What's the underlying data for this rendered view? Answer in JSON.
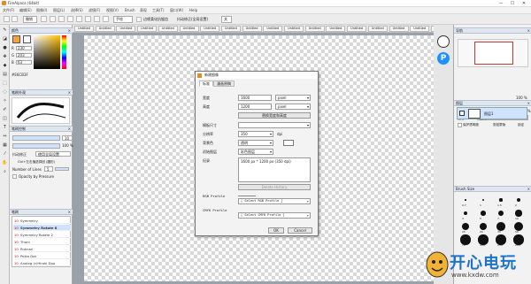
{
  "window": {
    "title": "FireAlpaca (64bit)",
    "minimize": "—",
    "maximize": "☐",
    "close": "✕"
  },
  "menu": [
    "文件(F)",
    "编辑(E)",
    "图像(I)",
    "图层(L)",
    "选择(S)",
    "滤镜(F)",
    "视图(V)",
    "Brush",
    "表现",
    "工具(T)",
    "窗口(W)",
    "Help"
  ],
  "toolbar": {
    "undo_label": "撤销",
    "mode": "手绘",
    "checkbox_label": "边缘柔化抗锯齿",
    "snap": "抖动修正(全局设置)",
    "extra": "关"
  },
  "doc_tabs": [
    "Untitled",
    "Untitled",
    "Untitled",
    "Untitled",
    "Untitled",
    "Untitled",
    "Untitled",
    "Untitled",
    "Untitled",
    "Untitled",
    "Untitled",
    "Untitled",
    "Untitled",
    "Untitled",
    "Untitled",
    "Untitled",
    "Untitled",
    "Untitled"
  ],
  "color_panel": {
    "title": "颜色",
    "r": "230",
    "g": "203",
    "b": "63",
    "hex": "#E6CB3F",
    "swatch_a": "#F4A23C",
    "swatch_b": "#FFFFFF"
  },
  "brush_preview": {
    "title": "笔刷外观"
  },
  "brush_control": {
    "title": "笔刷控制",
    "size": "10",
    "opacity": "100 %",
    "blend_label": "抖动修正",
    "blend_value": "使用全局设置",
    "shortcut_label": "Ctrl+左击值选择回 (圆形)",
    "number_of_lines_label": "Number of Lines",
    "number_of_lines": "5",
    "opacity_by_pressure": "Opacity by Pressure"
  },
  "brush_list": {
    "title": "笔刷",
    "items": [
      {
        "n": "10",
        "name": "Symmetry"
      },
      {
        "n": "10",
        "name": "Symmetry Rotate 8"
      },
      {
        "n": "10",
        "name": "Symmetry Rotate 2"
      },
      {
        "n": "10",
        "name": "Thorn"
      },
      {
        "n": "10",
        "name": "Ruknari"
      },
      {
        "n": "10",
        "name": "Polka Dot"
      },
      {
        "n": "10",
        "name": "Analog (c)Hiroki Dpa"
      }
    ],
    "selected_index": 1
  },
  "navigator": {
    "title": "导航",
    "zoom": "100 %"
  },
  "layers": {
    "title": "图层",
    "opacity_label": "不透明度",
    "opacity": "100 %",
    "blend_label": "混合",
    "blend": "正常",
    "protect_label": "保护透明度",
    "clip_label": "剪贴蒙版",
    "lock_label": "锁定",
    "layer_name": "图层1"
  },
  "brush_size": {
    "title": "Brush Size",
    "sizes": [
      "0.7",
      "1",
      "1.5",
      "2",
      "3",
      "5",
      "7",
      "10",
      "15",
      "20",
      "30",
      "50",
      "70",
      "100",
      "150",
      "200"
    ]
  },
  "dialog": {
    "title": "新建图像",
    "tab_standard": "标准",
    "tab_comic": "漫画原稿",
    "width_label": "宽度",
    "width": "1600",
    "width_unit": "pixel",
    "height_label": "高度",
    "height": "1200",
    "height_unit": "pixel",
    "swap_button": "替换宽度和高度",
    "preset_label": "模板尺寸",
    "dpi_label": "分辨率",
    "dpi": "350",
    "dpi_unit": "dpi",
    "bg_label": "背景色",
    "bg": "透明",
    "initial_label": "初始图层",
    "initial": "彩色图层",
    "note_label": "纪录",
    "note": "1600 px * 1200 px (350 dpi)",
    "delete_history": "Delete History",
    "rgb_label": "RGB Profile",
    "rgb": "[ Select RGB Profile ]",
    "cmyk_label": "CMYK Profile",
    "cmyk": "[ Select CMYK Profile ]",
    "ok": "OK",
    "cancel": "Cancel"
  },
  "watermark": {
    "text": "开心电玩",
    "url": "www.kxdw.com"
  }
}
